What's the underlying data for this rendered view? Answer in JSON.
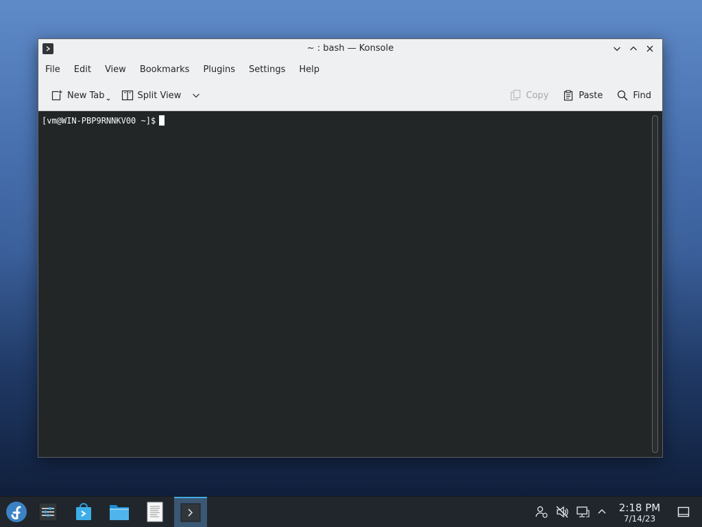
{
  "window": {
    "title": "~ : bash — Konsole",
    "controls": [
      "minimize-icon",
      "maximize-icon",
      "close-icon"
    ]
  },
  "menubar": {
    "items": [
      "File",
      "Edit",
      "View",
      "Bookmarks",
      "Plugins",
      "Settings",
      "Help"
    ]
  },
  "toolbar": {
    "new_tab": "New Tab",
    "split_view": "Split View",
    "copy": "Copy",
    "paste": "Paste",
    "find": "Find"
  },
  "terminal": {
    "prompt": "[vm@WIN-PBP9RNNKV00 ~]$"
  },
  "taskbar": {
    "apps": [
      "fedora-launcher-icon",
      "system-settings-icon",
      "discover-store-icon",
      "file-manager-icon",
      "text-editor-icon",
      "konsole-icon"
    ],
    "active_app": "konsole-icon"
  },
  "tray": {
    "icons": [
      "user-status-icon",
      "audio-muted-icon",
      "network-icon",
      "expand-tray-icon",
      "show-desktop-icon"
    ]
  },
  "clock": {
    "time": "2:18 PM",
    "date": "7/14/23"
  },
  "colors": {
    "accent": "#3daee9",
    "terminal_bg": "#232627",
    "window_bg": "#eff0f1",
    "taskbar_bg": "#21262c"
  }
}
